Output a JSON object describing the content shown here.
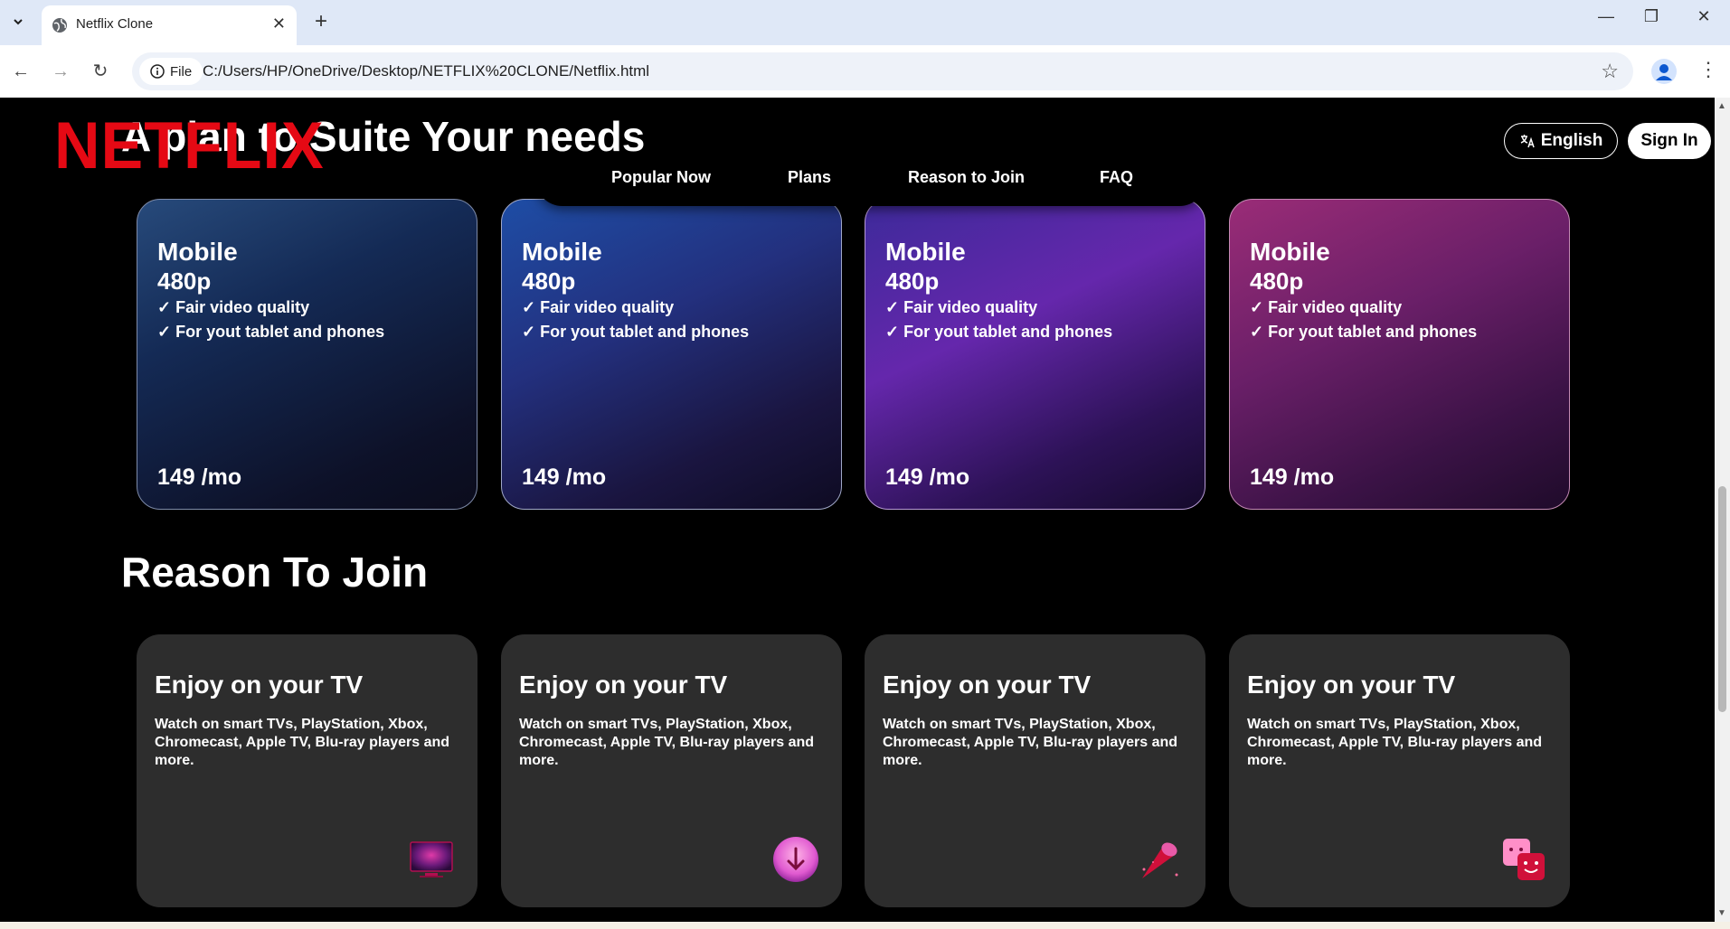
{
  "browser": {
    "tab_title": "Netflix Clone",
    "new_tab": "+",
    "chip_label": "File",
    "url": "C:/Users/HP/OneDrive/Desktop/NETFLIX%20CLONE/Netflix.html"
  },
  "header": {
    "logo": "NETFLIX",
    "plans_heading": "A plan to Suite Your needs",
    "language_label": "English",
    "signin_label": "Sign In"
  },
  "nav": {
    "items": [
      "Popular Now",
      "Plans",
      "Reason to Join",
      "FAQ"
    ]
  },
  "plans": [
    {
      "name": "Mobile",
      "resolution": "480p",
      "features": [
        "✓ Fair video quality",
        "✓ For yout tablet and phones"
      ],
      "price": "149 /mo"
    },
    {
      "name": "Mobile",
      "resolution": "480p",
      "features": [
        "✓ Fair video quality",
        "✓ For yout tablet and phones"
      ],
      "price": "149 /mo"
    },
    {
      "name": "Mobile",
      "resolution": "480p",
      "features": [
        "✓ Fair video quality",
        "✓ For yout tablet and phones"
      ],
      "price": "149 /mo"
    },
    {
      "name": "Mobile",
      "resolution": "480p",
      "features": [
        "✓ Fair video quality",
        "✓ For yout tablet and phones"
      ],
      "price": "149 /mo"
    }
  ],
  "reasons": {
    "heading": "Reason To Join",
    "cards": [
      {
        "title": "Enjoy on your TV",
        "text": "Watch on smart TVs, PlayStation, Xbox, Chromecast, Apple TV, Blu-ray players and more.",
        "icon": "tv-icon"
      },
      {
        "title": "Enjoy on your TV",
        "text": "Watch on smart TVs, PlayStation, Xbox, Chromecast, Apple TV, Blu-ray players and more.",
        "icon": "download-icon"
      },
      {
        "title": "Enjoy on your TV",
        "text": "Watch on smart TVs, PlayStation, Xbox, Chromecast, Apple TV, Blu-ray players and more.",
        "icon": "telescope-icon"
      },
      {
        "title": "Enjoy on your TV",
        "text": "Watch on smart TVs, PlayStation, Xbox, Chromecast, Apple TV, Blu-ray players and more.",
        "icon": "profiles-icon"
      }
    ]
  },
  "colors": {
    "brand_red": "#e50914",
    "card_bg": "#2d2d2d"
  }
}
